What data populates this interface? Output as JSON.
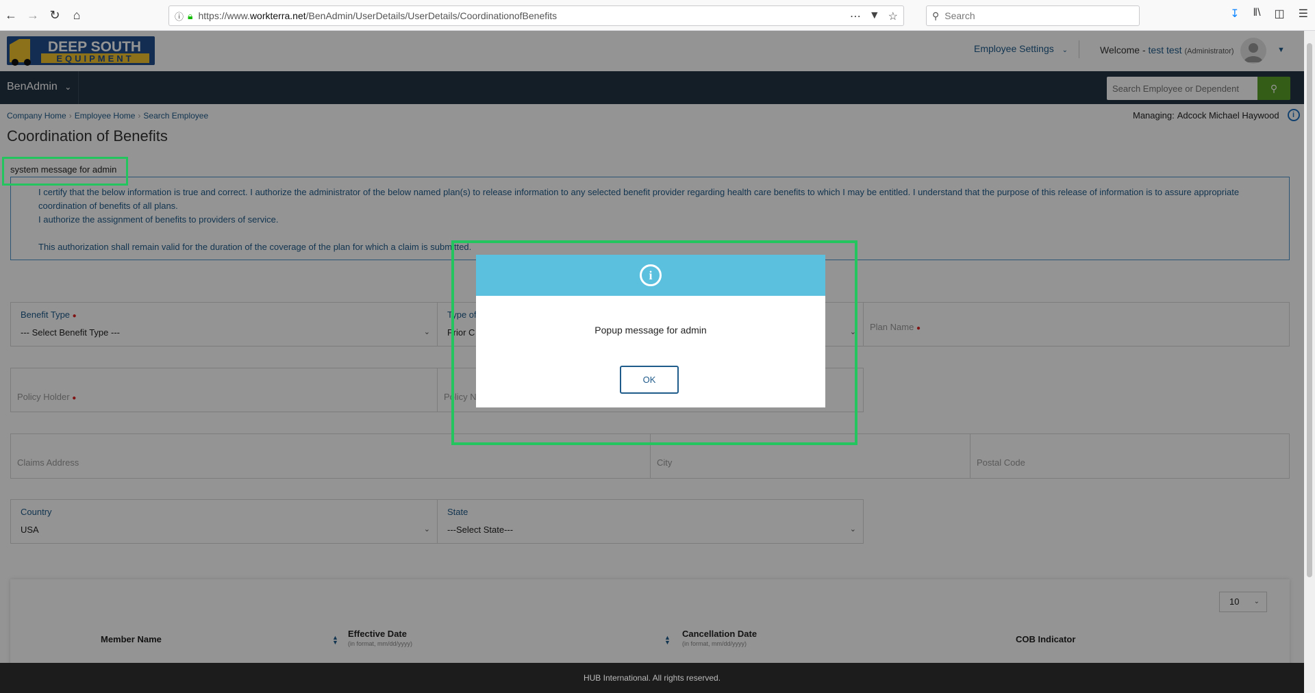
{
  "browser": {
    "url_prefix": "https://www.",
    "url_domain": "workterra.net",
    "url_path": "/BenAdmin/UserDetails/UserDetails/CoordinationofBenefits",
    "search_placeholder": "Search"
  },
  "header": {
    "logo_line1": "DEEP SOUTH",
    "logo_line2": "EQUIPMENT",
    "employee_settings": "Employee Settings",
    "welcome_label": "Welcome -",
    "user_name": "test test",
    "user_role": "(Administrator)"
  },
  "nav": {
    "module": "BenAdmin",
    "search_placeholder": "Search Employee or Dependent"
  },
  "breadcrumb": [
    "Company Home",
    "Employee Home",
    "Search Employee"
  ],
  "managing": {
    "label": "Managing:",
    "name": "Adcock Michael Haywood"
  },
  "page_title": "Coordination of Benefits",
  "system_message": "system message for admin",
  "consent": {
    "line1": "I certify that the below information is true and correct. I authorize the administrator of the below named plan(s) to release information to any selected benefit provider regarding health care benefits to which I may be entitled. I understand that the purpose of this release of information is to assure appropriate coordination of benefits of all plans.",
    "line2": "I authorize the assignment of benefits to providers of service.",
    "line3": "This authorization shall remain valid for the duration of the coverage of the plan for which a claim is submitted."
  },
  "form": {
    "benefit_type_label": "Benefit Type",
    "benefit_type_value": "--- Select Benefit Type ---",
    "type_of_label": "Type of",
    "type_of_value": "Prior C",
    "plan_name": "Plan Name",
    "policy_holder": "Policy Holder",
    "policy_no": "Policy N",
    "claims_address": "Claims Address",
    "city": "City",
    "postal_code": "Postal Code",
    "country_label": "Country",
    "country_value": "USA",
    "state_label": "State",
    "state_value": "---Select State---"
  },
  "table": {
    "page_size": "10",
    "columns": [
      {
        "label": "Member Name",
        "sub": ""
      },
      {
        "label": "Effective Date",
        "sub": "(in format, mm/dd/yyyy)"
      },
      {
        "label": "Cancellation Date",
        "sub": "(in format, mm/dd/yyyy)"
      },
      {
        "label": "COB Indicator",
        "sub": ""
      }
    ]
  },
  "footer": "HUB International. All rights reserved.",
  "modal": {
    "message": "Popup message for admin",
    "ok_label": "OK"
  },
  "colors": {
    "modal_header": "#5bc0de",
    "nav_dark": "#243444",
    "search_button": "#5aa32a",
    "highlight": "#22c55e"
  }
}
